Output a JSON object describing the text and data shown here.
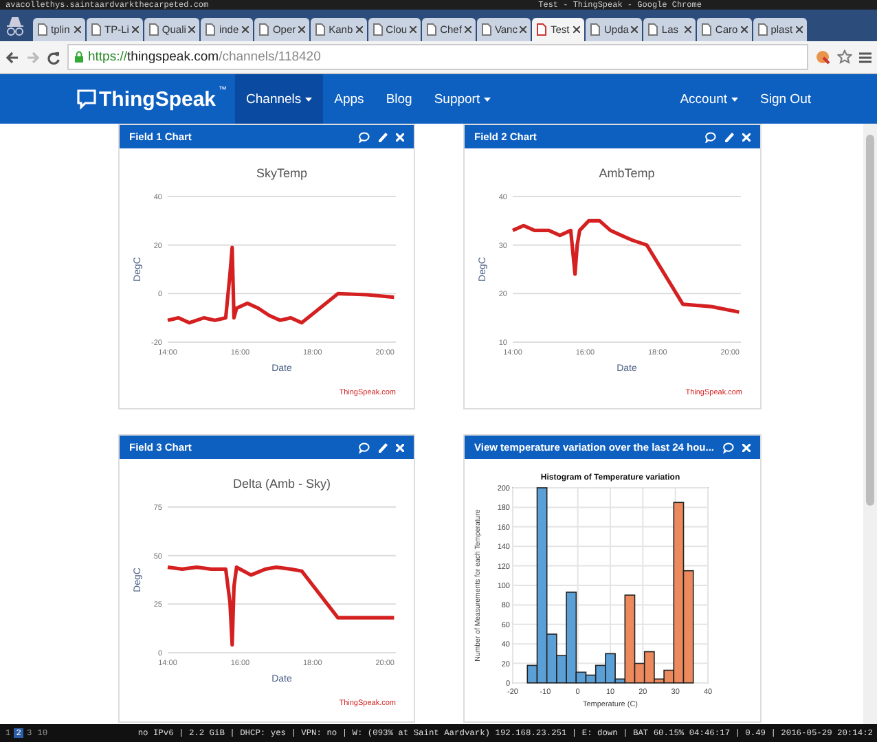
{
  "os_bar": {
    "host": "avacollethys.saintaardvarkthecarpeted.com",
    "title": "Test - ThingSpeak - Google Chrome"
  },
  "tabs": [
    {
      "label": "tplin",
      "selected": false
    },
    {
      "label": "TP-Li",
      "selected": false
    },
    {
      "label": "Quali",
      "selected": false
    },
    {
      "label": "inde",
      "selected": false
    },
    {
      "label": "Oper",
      "selected": false
    },
    {
      "label": "Kanb",
      "selected": false
    },
    {
      "label": "Clou",
      "selected": false
    },
    {
      "label": "Chef",
      "selected": false
    },
    {
      "label": "Vanc",
      "selected": false
    },
    {
      "label": "Test",
      "selected": true
    },
    {
      "label": "Upda",
      "selected": false
    },
    {
      "label": "Las",
      "selected": false
    },
    {
      "label": "Caro",
      "selected": false
    },
    {
      "label": "plast",
      "selected": false
    }
  ],
  "address_bar": {
    "scheme": "https://",
    "host": "thingspeak.com",
    "path": "/channels/118420"
  },
  "nav": {
    "brand": "ThingSpeak",
    "trademark": "™",
    "items": [
      {
        "label": "Channels",
        "dropdown": true,
        "selected": true
      },
      {
        "label": "Apps",
        "dropdown": false,
        "selected": false
      },
      {
        "label": "Blog",
        "dropdown": false,
        "selected": false
      },
      {
        "label": "Support",
        "dropdown": true,
        "selected": false
      }
    ],
    "right_items": [
      {
        "label": "Account",
        "dropdown": true
      },
      {
        "label": "Sign Out",
        "dropdown": false
      }
    ]
  },
  "cards": [
    {
      "title": "Field 1 Chart",
      "editable": true,
      "credit": "ThingSpeak.com",
      "chart_data": {
        "type": "line",
        "title": "SkyTemp",
        "xlabel": "Date",
        "ylabel": "DegC",
        "x": [
          14,
          14.3,
          14.6,
          15,
          15.3,
          15.6,
          15.72,
          15.78,
          15.83,
          15.9,
          16.2,
          16.5,
          16.8,
          17.1,
          17.4,
          17.7,
          18.7,
          19.5,
          20.25
        ],
        "grid": true,
        "series": [
          {
            "color": "#d42020",
            "values": [
              -11,
              -10,
              -12,
              -10,
              -11,
              -10,
              8,
              19,
              -10,
              -6,
              -4,
              -6,
              -9,
              -11,
              -10,
              -12,
              0,
              -0.5,
              -1.5
            ]
          }
        ],
        "xlim": [
          14,
          20.3
        ],
        "ylim": [
          -20,
          40
        ],
        "yticks": [
          -20,
          0,
          20,
          40
        ],
        "xticks": [
          {
            "value": 14,
            "label": "14:00"
          },
          {
            "value": 16,
            "label": "16:00"
          },
          {
            "value": 18,
            "label": "18:00"
          },
          {
            "value": 20,
            "label": "20:00"
          }
        ]
      }
    },
    {
      "title": "Field 2 Chart",
      "editable": true,
      "credit": "ThingSpeak.com",
      "chart_data": {
        "type": "line",
        "title": "AmbTemp",
        "xlabel": "Date",
        "ylabel": "DegC",
        "x": [
          14,
          14.3,
          14.6,
          15,
          15.3,
          15.6,
          15.72,
          15.78,
          15.85,
          16.1,
          16.4,
          16.7,
          17,
          17.3,
          17.7,
          18.7,
          19.5,
          20.25
        ],
        "grid": true,
        "series": [
          {
            "color": "#d42020",
            "values": [
              33,
              34,
              33,
              33,
              32,
              33,
              24,
              30,
              33,
              35,
              35,
              33,
              32,
              31,
              30,
              17.8,
              17.3,
              16.2
            ]
          }
        ],
        "xlim": [
          14,
          20.3
        ],
        "ylim": [
          10,
          40
        ],
        "yticks": [
          10,
          20,
          30,
          40
        ],
        "xticks": [
          {
            "value": 14,
            "label": "14:00"
          },
          {
            "value": 16,
            "label": "16:00"
          },
          {
            "value": 18,
            "label": "18:00"
          },
          {
            "value": 20,
            "label": "20:00"
          }
        ]
      }
    },
    {
      "title": "Field 3 Chart",
      "editable": true,
      "credit": "ThingSpeak.com",
      "chart_data": {
        "type": "line",
        "title": "Delta (Amb - Sky)",
        "xlabel": "Date",
        "ylabel": "DegC",
        "x": [
          14,
          14.4,
          14.8,
          15.2,
          15.6,
          15.72,
          15.78,
          15.83,
          15.9,
          16.3,
          16.7,
          17,
          17.4,
          17.7,
          18.7,
          19.5,
          20.25
        ],
        "grid": true,
        "series": [
          {
            "color": "#d42020",
            "values": [
              44,
              43,
              44,
              43,
              43,
              26,
              4,
              34,
              44,
              40,
              43,
              44,
              43,
              42,
              18,
              18,
              18
            ]
          }
        ],
        "xlim": [
          14,
          20.3
        ],
        "ylim": [
          0,
          75
        ],
        "yticks": [
          0,
          25,
          50,
          75
        ],
        "xticks": [
          {
            "value": 14,
            "label": "14:00"
          },
          {
            "value": 16,
            "label": "16:00"
          },
          {
            "value": 18,
            "label": "18:00"
          },
          {
            "value": 20,
            "label": "20:00"
          }
        ]
      }
    },
    {
      "title": "View temperature variation over the last 24 hou...",
      "editable": false,
      "chart_data": {
        "type": "bar",
        "title": "Histogram of Temperature variation",
        "xlabel": "Temperature (C)",
        "ylabel": "Number of Measurements for each Temperature",
        "x": [
          -14,
          -11,
          -8,
          -5,
          -2,
          1,
          4,
          7,
          10,
          13,
          16,
          19,
          22,
          25,
          28,
          31,
          34
        ],
        "grid": true,
        "series": [
          {
            "color": "#5a9fd6",
            "values": [
              18,
              200,
              50,
              28,
              93,
              11,
              8,
              18,
              30,
              4,
              null,
              null,
              null,
              null,
              null,
              null,
              null
            ]
          },
          {
            "color": "#ec8a5e",
            "values": [
              null,
              null,
              null,
              null,
              null,
              null,
              null,
              null,
              null,
              null,
              90,
              20,
              32,
              4,
              13,
              185,
              115
            ]
          }
        ],
        "xlim": [
          -20,
          40
        ],
        "ylim": [
          0,
          200
        ],
        "xticks": [
          -20,
          -10,
          0,
          10,
          20,
          30,
          40
        ],
        "yticks": [
          0,
          20,
          40,
          60,
          80,
          100,
          120,
          140,
          160,
          180,
          200
        ]
      }
    }
  ],
  "status_bar": {
    "workspaces": [
      {
        "label": "1",
        "selected": false
      },
      {
        "label": "2",
        "selected": true
      },
      {
        "label": "3",
        "selected": false
      },
      {
        "label": "10",
        "selected": false
      }
    ],
    "text": "no IPv6 | 2.2 GiB | DHCP: yes | VPN: no | W: (093% at Saint Aardvark) 192.168.23.251 | E: down | BAT 60.15% 04:46:17 | 0.49 | 2016-05-29 20:14:2"
  }
}
